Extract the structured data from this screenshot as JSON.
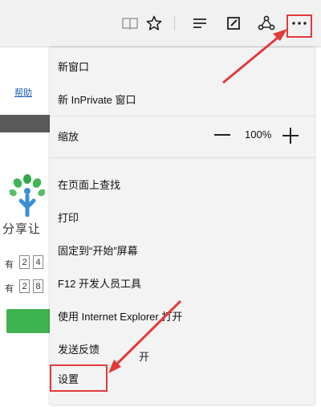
{
  "toolbar": {
    "icons": [
      "reading-view-icon",
      "favorite-star-icon",
      "hub-icon",
      "web-note-icon",
      "share-icon",
      "more-actions-icon"
    ]
  },
  "background_page": {
    "help_link": "帮助",
    "logo_text": "分享让",
    "rows": [
      {
        "label": "有",
        "cells": [
          "2",
          "4"
        ]
      },
      {
        "label": "有",
        "cells": [
          "2",
          "8"
        ]
      }
    ]
  },
  "menu": {
    "new_window": "新窗口",
    "new_inprivate": "新 InPrivate 窗口",
    "zoom_label": "缩放",
    "zoom_value": "100%",
    "find_on_page": "在页面上查找",
    "print": "打印",
    "pin_to_start": "固定到“开始”屏幕",
    "f12_tools": "F12 开发人员工具",
    "open_with_ie": "使用 Internet Explorer 打开",
    "send_feedback": "发送反馈",
    "settings": "设置",
    "stray_text": "开"
  },
  "colors": {
    "annotation_red": "#e23a3a",
    "menu_bg": "#f3f3f3",
    "toolbar_bg": "#f1f1f1",
    "green_button": "#3fb34f"
  }
}
